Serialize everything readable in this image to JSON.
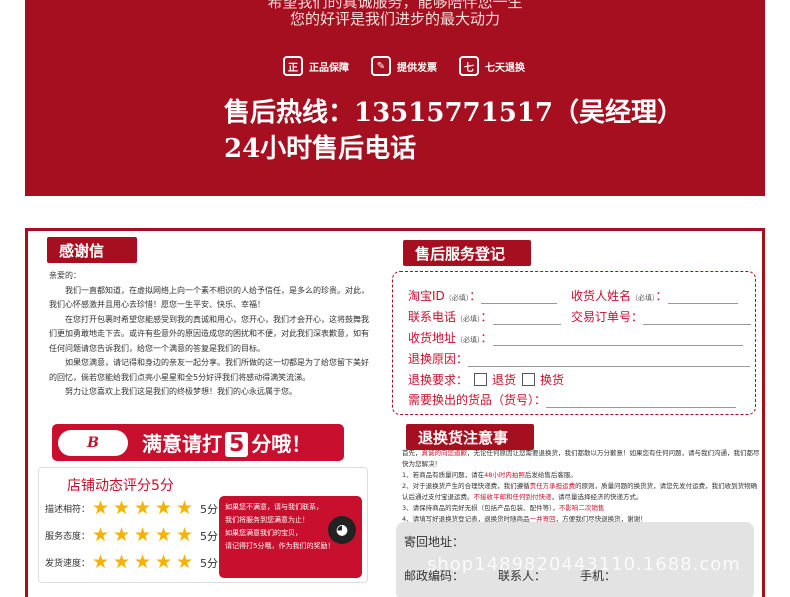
{
  "banner": {
    "line1": "希望我们的真诚服务，能够陪伴您一生",
    "line2": "您的好评是我们进步的最大动力",
    "badges": [
      {
        "icon": "genuine-icon",
        "glyph": "正",
        "label": "正品保障"
      },
      {
        "icon": "invoice-icon",
        "glyph": "✎",
        "label": "提供发票"
      },
      {
        "icon": "return-7day-icon",
        "glyph": "七",
        "label": "七天退换"
      }
    ],
    "hotline": "售后热线：13515771517（吴经理）",
    "hotline_sub": "24小时售后电话"
  },
  "thanks": {
    "tab": "感谢信",
    "greeting": "亲爱的：",
    "paragraphs": [
      "我们一直都知道，在虚拟网络上向一个素不相识的人给予信任，是多么的珍贵。对此，我们心怀感激并且用心去珍惜！愿您一生平安、快乐、幸福！",
      "在您打开包裹时希望您能感受到我的真诚和用心，您开心，我们才会开心，这将鼓舞我们更加勇敢地走下去。或许有些意外的原因造成您的困扰和不便，对此我们深表歉意，如有任何问题请您告诉我们，给您一个满意的答复是我们的目标。",
      "如果您满意，请记得和身边的亲友一起分享。我们所做的这一切都是为了给您留下美好的回忆，倘若您能给我们点亮小星星和全5分好评我们将感动得满笑流涕。",
      "努力让您喜欢上我们这是我们的终极梦想！我们的心永远属于您。"
    ]
  },
  "rating_banner": {
    "logo": "B",
    "text_before": "满意请打",
    "big_number": "5",
    "text_after": "分哦！"
  },
  "shop_score": {
    "title": "店铺动态评分5分",
    "rows": [
      {
        "label": "描述相符：",
        "stars": 5,
        "value": "5分"
      },
      {
        "label": "服务态度：",
        "stars": 5,
        "value": "5分"
      },
      {
        "label": "发货速度：",
        "stars": 5,
        "value": "5分"
      }
    ],
    "promo_lines": [
      "如果您不满意，请与我们联系，",
      "我们将服务到您满意为止！",
      "如果您满意我们的宝贝，",
      "请记得打5分哦，作为我们的奖励！"
    ]
  },
  "registration": {
    "tab": "售后服务登记表",
    "required": "（必填）",
    "fields": {
      "taobao_id": "淘宝ID",
      "receiver_name": "收货人姓名",
      "phone": "联系电话",
      "order_no": "交易订单号",
      "address": "收货地址",
      "reason": "退换原因：",
      "request": "退换要求：",
      "refund": "退货",
      "exchange": "换货",
      "goods": "需要换出的货品（货号）："
    }
  },
  "notice": {
    "tab": "退换货注意事项",
    "intro_parts": [
      "首先，",
      "真诚的向您道歉",
      "，无论任何原因让您需要退换货，我们都散以万分歉意！如果您有任何问题，请与我们沟通，我们都尽快为您解决！"
    ],
    "items": [
      [
        "1、若商品有质量问题，请在",
        "48小时内拍照",
        "后发给售后客服。"
      ],
      [
        "2、对于退换货产生的合理快递费，我们遵循",
        "责任方承担运费",
        "的原则，质量问题的换货货，请您先发付运费，我们收到货物确认后通过支付宝退运费。",
        "不接收平邮和任何到付快递",
        "，请尽量选择经济的快递方式。"
      ],
      [
        "3、请保持商品的完好无损（包括产品包装、配件等），",
        "不影响二次销售",
        ""
      ],
      [
        "4、请填写好退换货登记表，退换货时随商品",
        "一并寄回",
        "，方便我们尽快退换货，谢谢！"
      ]
    ]
  },
  "return_address": {
    "label": "寄回地址：",
    "postcode": "邮政编码：",
    "contact": "联系人：",
    "mobile": "手机：",
    "watermark": "shop1489820443110.1688.com"
  }
}
